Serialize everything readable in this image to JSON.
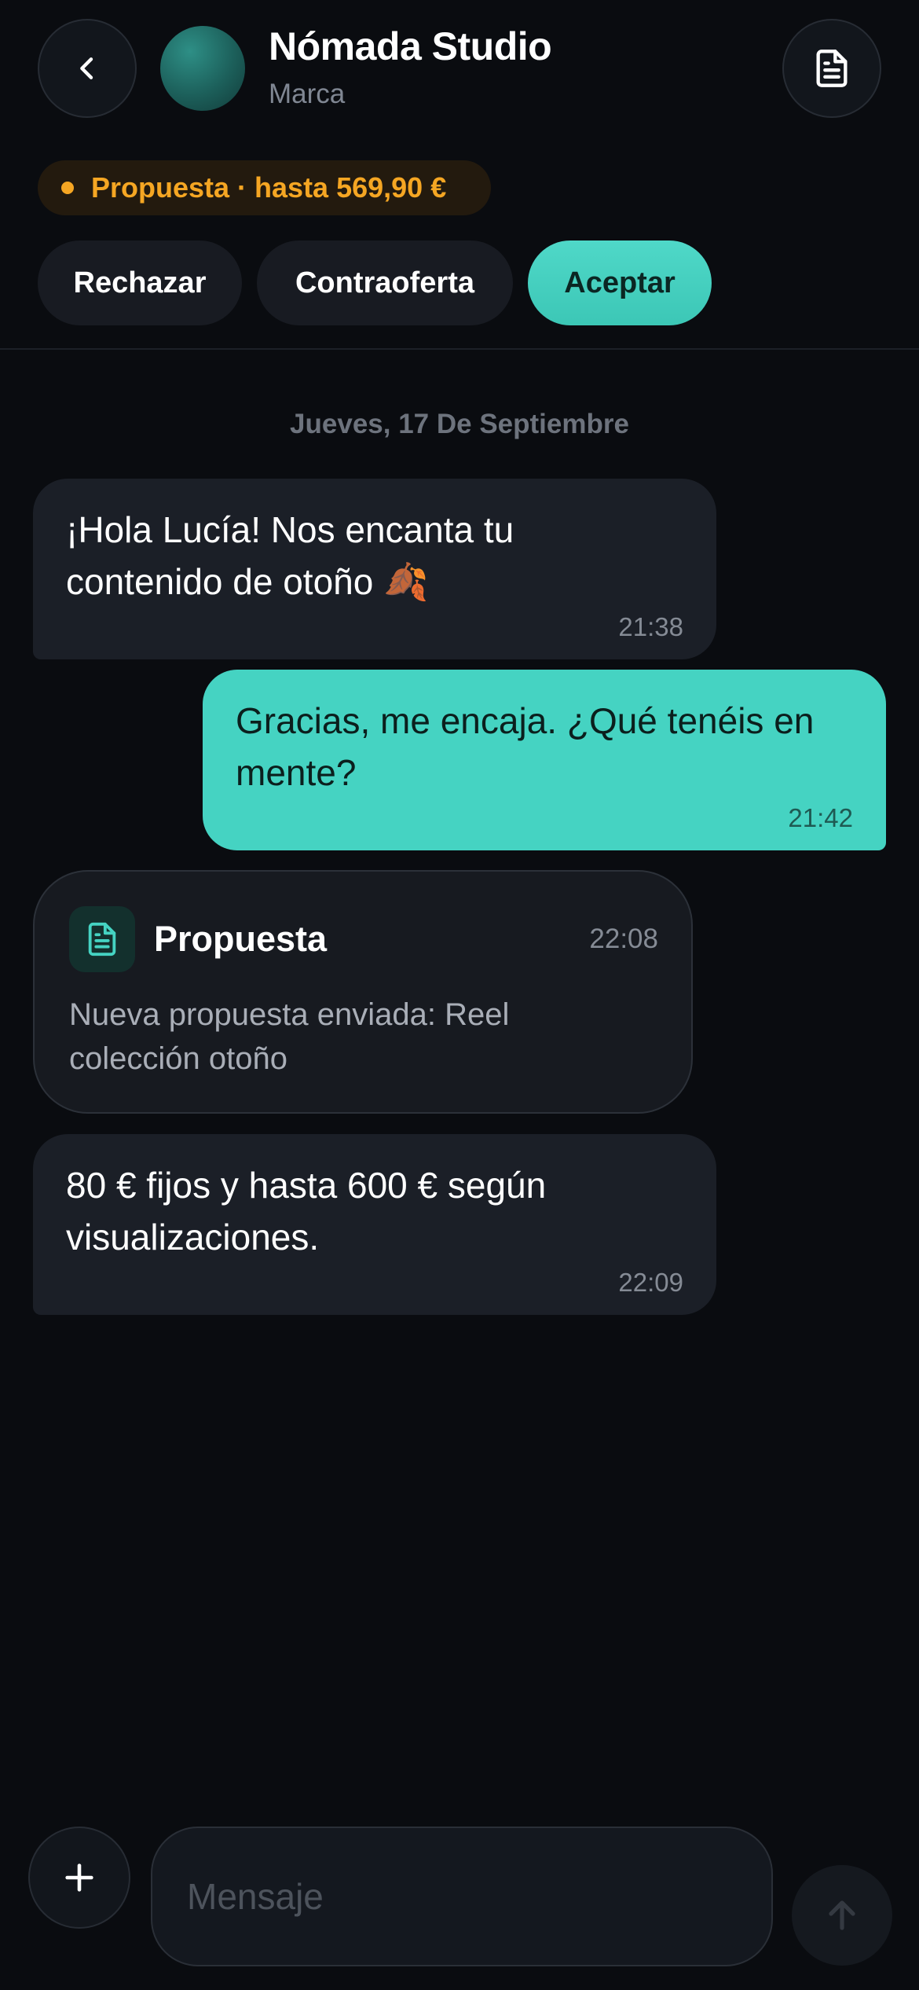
{
  "header": {
    "back_icon": "chevron-left-icon",
    "contact_name": "Nómada Studio",
    "contact_subtitle": "Marca",
    "document_icon": "document-icon"
  },
  "proposal_status": {
    "label": "Propuesta · hasta 569,90 €",
    "color": "#f5a623"
  },
  "actions": {
    "reject": "Rechazar",
    "counteroffer": "Contraoferta",
    "accept": "Aceptar",
    "accent_color": "#45d3c2"
  },
  "chat": {
    "date_separator": "Jueves, 17 De Septiembre",
    "messages": [
      {
        "direction": "incoming",
        "text": "¡Hola Lucía! Nos encanta tu contenido de otoño 🍂",
        "time": "21:38"
      },
      {
        "direction": "outgoing",
        "text": "Gracias, me encaja. ¿Qué tenéis en mente?",
        "time": "21:42"
      },
      {
        "direction": "incoming",
        "type": "proposal_card",
        "icon": "document-icon",
        "title": "Propuesta",
        "description": "Nueva propuesta enviada: Reel colección otoño",
        "time": "22:08"
      },
      {
        "direction": "incoming",
        "text": "80 € fijos y hasta 600 € según visualizaciones.",
        "time": "22:09"
      }
    ]
  },
  "composer": {
    "attach_icon": "plus-icon",
    "placeholder": "Mensaje",
    "value": "",
    "send_icon": "arrow-up-icon"
  }
}
